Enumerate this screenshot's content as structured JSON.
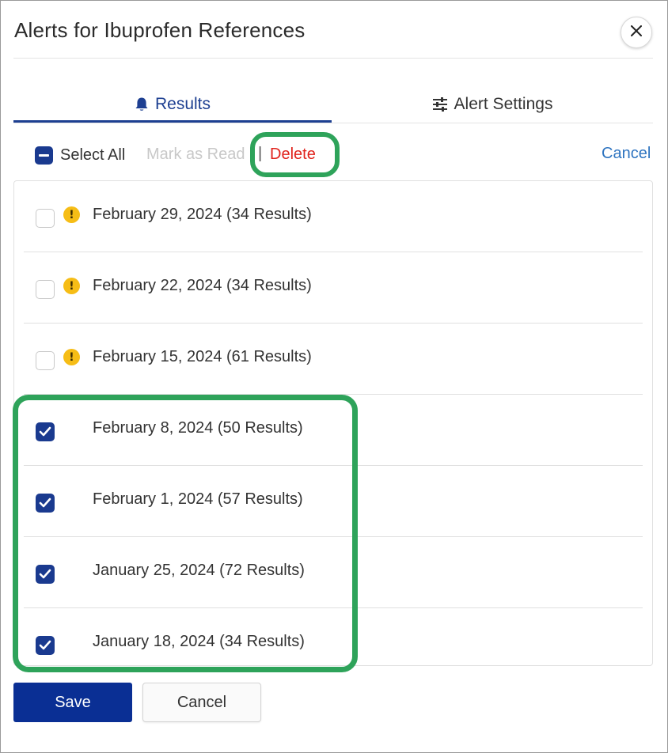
{
  "dialog": {
    "title": "Alerts for Ibuprofen References",
    "close_icon": "close-icon"
  },
  "tabs": [
    {
      "label": "Results",
      "icon": "bell-icon",
      "active": true
    },
    {
      "label": "Alert Settings",
      "icon": "sliders-icon",
      "active": false
    }
  ],
  "toolbar": {
    "select_all_label": "Select All",
    "select_all_state": "indeterminate",
    "mark_as_read_label": "Mark as Read",
    "separator": "|",
    "delete_label": "Delete",
    "cancel_label": "Cancel"
  },
  "alerts": [
    {
      "label": "February 29, 2024 (34 Results)",
      "checked": false,
      "unread": true
    },
    {
      "label": "February 22, 2024 (34 Results)",
      "checked": false,
      "unread": true
    },
    {
      "label": "February 15, 2024 (61 Results)",
      "checked": false,
      "unread": true
    },
    {
      "label": "February 8, 2024 (50 Results)",
      "checked": true,
      "unread": false
    },
    {
      "label": "February 1, 2024 (57 Results)",
      "checked": true,
      "unread": false
    },
    {
      "label": "January 25, 2024 (72 Results)",
      "checked": true,
      "unread": false
    },
    {
      "label": "January 18, 2024 (34 Results)",
      "checked": true,
      "unread": false
    }
  ],
  "footer": {
    "save_label": "Save",
    "cancel_label": "Cancel"
  },
  "colors": {
    "primary": "#0a2f94",
    "tab_active": "#1d3f91",
    "delete": "#e0231c",
    "link": "#2e74c0",
    "warning": "#f6bd16",
    "highlight": "#2ea35a",
    "disabled_text": "#c8c8c8"
  }
}
